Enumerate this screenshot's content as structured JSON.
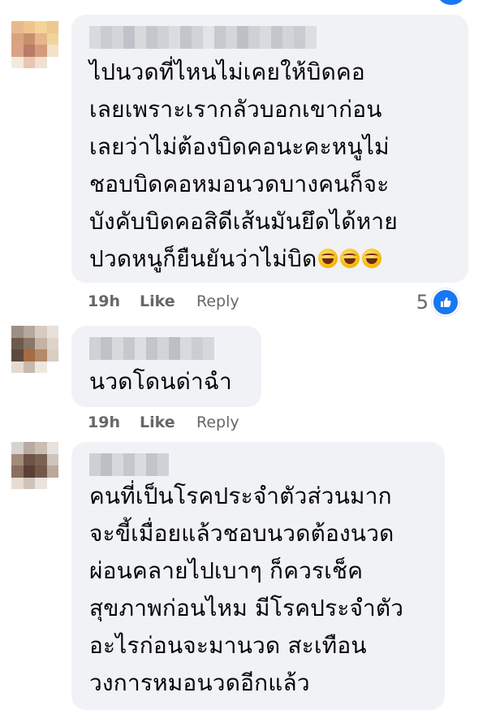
{
  "comments": [
    {
      "body": "ไปนวดที่ไหนไม่เคยให้บิดคอ\nเลยเพราะเรากลัวบอกเขาก่อน\nเลยว่าไม่ต้องบิดคอนะคะหนูไม่\nชอบบิดคอหมอนวดบางคนก็จะ\nบังคับบิดคอสิดีเส้นมันยึดได้หาย\nปวดหนูก็ยืนยันว่าไม่บิด",
      "emoji": "rolling-on-floor-laughing",
      "time": "19h",
      "like": "Like",
      "reply": "Reply",
      "reaction_count": "5"
    },
    {
      "body": "นวดโดนด่าฉำ",
      "time": "19h",
      "like": "Like",
      "reply": "Reply"
    },
    {
      "body": "คนที่เป็นโรคประจำตัวส่วนมาก\nจะขี้เมื่อยแล้วชอบนวดต้องนวด\nผ่อนคลายไปเบาๆ ก็ควรเช็ค\nสุขภาพก่อนไหม มีโรคประจำตัว\nอะไรก่อนจะมานวด สะเทือน\nวงการหมอนวดอีกแล้ว"
    }
  ],
  "icons": {
    "reaction": "like-icon",
    "emoji": "rolling-on-floor-laughing-emoji"
  },
  "colors": {
    "bubble": "#f0f2f5",
    "meta_text": "#65676b",
    "like_blue": "#1877f2",
    "text": "#050505"
  }
}
